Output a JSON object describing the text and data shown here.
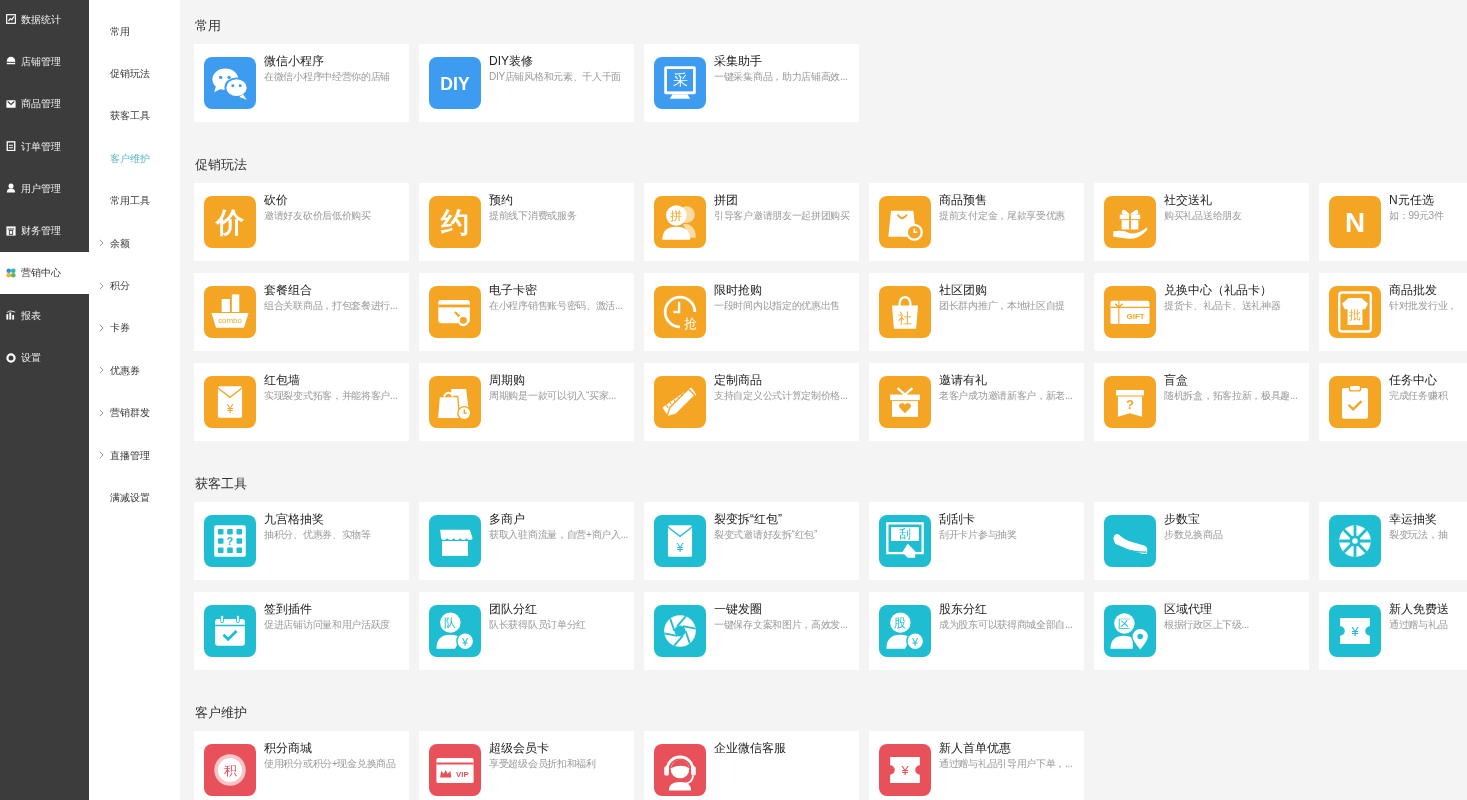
{
  "nav": [
    {
      "label": "数据统计",
      "kind": "chart",
      "selected": false
    },
    {
      "label": "店铺管理",
      "kind": "shop",
      "selected": false
    },
    {
      "label": "商品管理",
      "kind": "goods",
      "selected": false
    },
    {
      "label": "订单管理",
      "kind": "order",
      "selected": false
    },
    {
      "label": "用户管理",
      "kind": "user",
      "selected": false
    },
    {
      "label": "财务管理",
      "kind": "finance",
      "selected": false
    },
    {
      "label": "营销中心",
      "kind": "marketing",
      "selected": true
    },
    {
      "label": "报表",
      "kind": "report",
      "selected": false
    },
    {
      "label": "设置",
      "kind": "settings",
      "selected": false
    }
  ],
  "subnav": [
    {
      "label": "常用",
      "kind": "link",
      "selected": false
    },
    {
      "label": "促销玩法",
      "kind": "link",
      "selected": false
    },
    {
      "label": "获客工具",
      "kind": "link",
      "selected": false
    },
    {
      "label": "客户维护",
      "kind": "link",
      "selected": true
    },
    {
      "label": "常用工具",
      "kind": "link",
      "selected": false
    },
    {
      "label": "余额",
      "kind": "group",
      "selected": false
    },
    {
      "label": "积分",
      "kind": "group",
      "selected": false
    },
    {
      "label": "卡券",
      "kind": "group",
      "selected": false
    },
    {
      "label": "优惠券",
      "kind": "group",
      "selected": false
    },
    {
      "label": "营销群发",
      "kind": "group",
      "selected": false
    },
    {
      "label": "直播管理",
      "kind": "group",
      "selected": false
    },
    {
      "label": "满减设置",
      "kind": "link",
      "selected": false
    }
  ],
  "sections": [
    {
      "title": "常用",
      "color": "#3d9cf0",
      "cards": [
        {
          "title": "微信小程序",
          "desc": "在微信小程序中经营你的店铺",
          "kind": "chat"
        },
        {
          "title": "DIY装修",
          "desc": "DIY店铺风格和元素、千人千面",
          "kind": "letters",
          "glyphs": [
            "DIY"
          ]
        },
        {
          "title": "采集助手",
          "desc": "一键采集商品，助力店铺高效...",
          "kind": "board",
          "glyphs": [
            "采"
          ]
        }
      ]
    },
    {
      "title": "促销玩法",
      "color": "#f5a524",
      "cards": [
        {
          "title": "砍价",
          "desc": "邀请好友砍价后低价购买",
          "kind": "letters",
          "glyphs": [
            "价"
          ]
        },
        {
          "title": "预约",
          "desc": "提前线下消费或服务",
          "kind": "letters",
          "glyphs": [
            "约"
          ]
        },
        {
          "title": "拼团",
          "desc": "引导客户邀请朋友一起拼团购买",
          "kind": "people",
          "glyphs": [
            "拼"
          ]
        },
        {
          "title": "商品预售",
          "desc": "提前支付定金，尾款享受优惠",
          "kind": "bag"
        },
        {
          "title": "社交送礼",
          "desc": "购买礼品送给朋友",
          "kind": "gift"
        },
        {
          "title": "N元任选",
          "desc": "如：99元3件",
          "kind": "letters",
          "glyphs": [
            "N"
          ]
        },
        {
          "title": "套餐组合",
          "desc": "组合关联商品，打包套餐进行...",
          "kind": "combo",
          "glyphs": [
            "combo"
          ]
        },
        {
          "title": "电子卡密",
          "desc": "在小程序销售账号密码、激活...",
          "kind": "card"
        },
        {
          "title": "限时抢购",
          "desc": "一段时间内以指定的优惠出售",
          "kind": "clock",
          "glyphs": [
            "抢"
          ]
        },
        {
          "title": "社区团购",
          "desc": "团长群内推广，本地社区自提",
          "kind": "tote",
          "glyphs": [
            "社"
          ]
        },
        {
          "title": "兑换中心（礼品卡）",
          "desc": "提货卡、礼品卡、送礼神器",
          "kind": "giftcard",
          "glyphs": [
            "GIFT"
          ]
        },
        {
          "title": "商品批发",
          "desc": "针对批发行业，",
          "kind": "phone",
          "glyphs": [
            "批"
          ]
        },
        {
          "title": "红包墙",
          "desc": "实现裂变式拓客，并能将客户...",
          "kind": "envelope",
          "glyphs": [
            "¥"
          ]
        },
        {
          "title": "周期购",
          "desc": "周期购是一款可以切入“买家...",
          "kind": "bags"
        },
        {
          "title": "定制商品",
          "desc": "支持自定义公式计算定制价格...",
          "kind": "pencil"
        },
        {
          "title": "邀请有礼",
          "desc": "老客户成功邀请新客户，新老...",
          "kind": "giftbox"
        },
        {
          "title": "盲盒",
          "desc": "随机拆盒，拓客拉新，极具趣...",
          "kind": "crate",
          "glyphs": [
            "?"
          ]
        },
        {
          "title": "任务中心",
          "desc": "完成任务赚积",
          "kind": "clipboard"
        }
      ]
    },
    {
      "title": "获客工具",
      "color": "#1fbdd2",
      "cards": [
        {
          "title": "九宫格抽奖",
          "desc": "抽积分、优惠券、实物等",
          "kind": "grid",
          "glyphs": [
            "?"
          ]
        },
        {
          "title": "多商户",
          "desc": "获取入驻商流量，自营+商户入...",
          "kind": "store"
        },
        {
          "title": "裂变拆“红包”",
          "desc": "裂变式邀请好友拆“红包”",
          "kind": "envelope",
          "glyphs": [
            "¥"
          ]
        },
        {
          "title": "刮刮卡",
          "desc": "刮开卡片参与抽奖",
          "kind": "scratch",
          "glyphs": [
            "刮"
          ]
        },
        {
          "title": "步数宝",
          "desc": "步数兑换商品",
          "kind": "shoe"
        },
        {
          "title": "幸运抽奖",
          "desc": "裂变玩法，抽",
          "kind": "wheel"
        },
        {
          "title": "签到插件",
          "desc": "促进店铺访问量和用户活跃度",
          "kind": "calendar"
        },
        {
          "title": "团队分红",
          "desc": "队长获得队员订单分红",
          "kind": "member",
          "glyphs": [
            "队",
            "¥"
          ]
        },
        {
          "title": "一键发圈",
          "desc": "一键保存文案和图片，高效发...",
          "kind": "aperture"
        },
        {
          "title": "股东分红",
          "desc": "成为股东可以获得商城全部自...",
          "kind": "member",
          "glyphs": [
            "股",
            "¥"
          ]
        },
        {
          "title": "区域代理",
          "desc": "根据行政区上下级...",
          "kind": "locator",
          "glyphs": [
            "区"
          ]
        },
        {
          "title": "新人免费送",
          "desc": "通过赠与礼品",
          "kind": "ticket",
          "glyphs": [
            "¥"
          ]
        }
      ]
    },
    {
      "title": "客户维护",
      "color": "#e8515a",
      "cards": [
        {
          "title": "积分商城",
          "desc": "使用积分或积分+现金兑换商品",
          "kind": "coin",
          "glyphs": [
            "积"
          ]
        },
        {
          "title": "超级会员卡",
          "desc": "享受超级会员折扣和福利",
          "kind": "vip",
          "glyphs": [
            "VIP"
          ]
        },
        {
          "title": "企业微信客服",
          "kind": "headset"
        },
        {
          "title": "新人首单优惠",
          "desc": "通过赠与礼品引导用户下单，...",
          "kind": "ticket",
          "glyphs": [
            "¥"
          ]
        }
      ]
    }
  ]
}
